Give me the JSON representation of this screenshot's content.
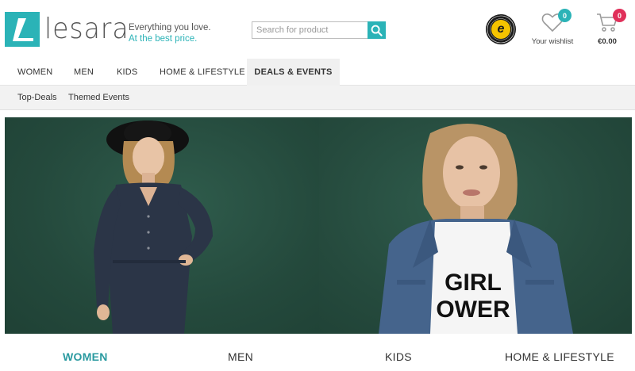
{
  "brand": {
    "name": "lesara",
    "tagline_line1": "Everything you love.",
    "tagline_line2": "At the best price.",
    "accent_color": "#2bb3b7"
  },
  "search": {
    "placeholder": "Search for product",
    "icon": "search-icon"
  },
  "trust_badge": {
    "letter": "e",
    "ring_text": "TRUSTED SHOPS GUARANTEE"
  },
  "wishlist": {
    "count": "0",
    "label": "Your wishlist",
    "icon": "heart-icon"
  },
  "cart": {
    "count": "0",
    "amount": "€0.00",
    "icon": "cart-icon"
  },
  "nav": {
    "items": [
      {
        "label": "WOMEN"
      },
      {
        "label": "MEN"
      },
      {
        "label": "KIDS"
      },
      {
        "label": "HOME & LIFESTYLE"
      },
      {
        "label": "DEALS & EVENTS",
        "active": true
      }
    ]
  },
  "subnav": {
    "items": [
      {
        "label": "Top-Deals"
      },
      {
        "label": "Themed Events"
      }
    ]
  },
  "hero": {
    "right_shirt_text_line1": "GIRL",
    "right_shirt_text_line2": "OWER"
  },
  "categories": {
    "items": [
      {
        "label": "WOMEN",
        "active": true
      },
      {
        "label": "MEN"
      },
      {
        "label": "KIDS"
      },
      {
        "label": "HOME & LIFESTYLE"
      }
    ]
  }
}
